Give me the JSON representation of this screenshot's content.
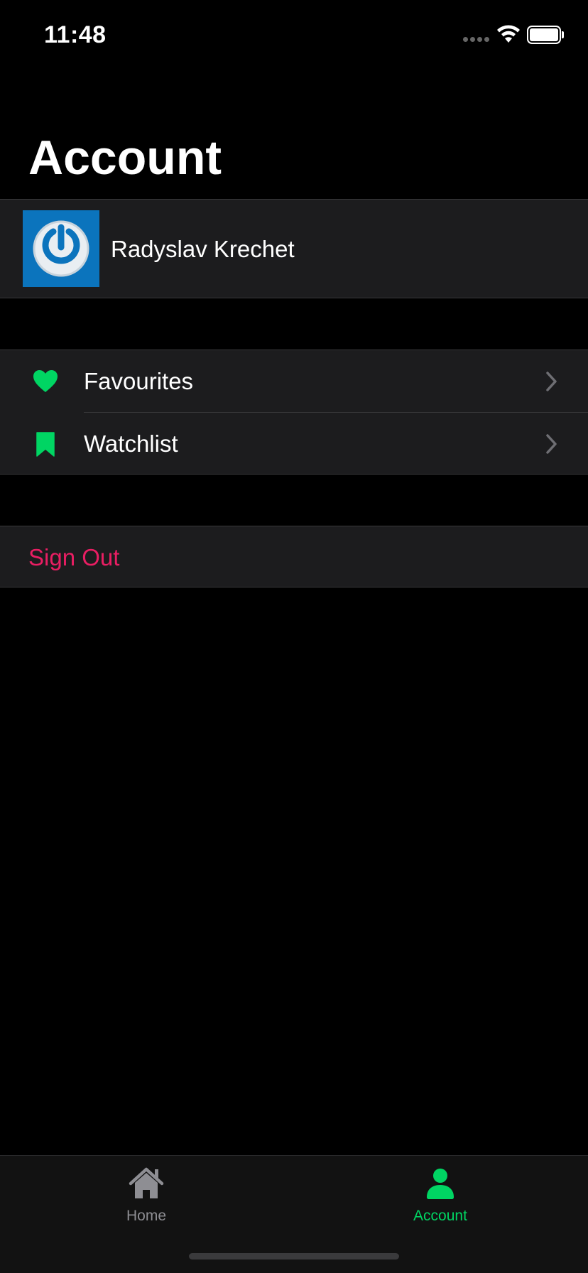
{
  "status_bar": {
    "time": "11:48"
  },
  "page": {
    "title": "Account"
  },
  "profile": {
    "name": "Radyslav Krechet",
    "avatar_icon": "power-icon"
  },
  "menu": {
    "items": [
      {
        "label": "Favourites",
        "icon": "heart-icon"
      },
      {
        "label": "Watchlist",
        "icon": "bookmark-icon"
      }
    ]
  },
  "actions": {
    "sign_out_label": "Sign Out"
  },
  "tab_bar": {
    "tabs": [
      {
        "label": "Home",
        "icon": "house-icon",
        "selected": false
      },
      {
        "label": "Account",
        "icon": "person-icon",
        "selected": true
      }
    ]
  },
  "colors": {
    "accent": "#00d563",
    "destructive": "#e91e63",
    "group_background": "#1c1c1e",
    "avatar_background": "#0b74bd"
  }
}
